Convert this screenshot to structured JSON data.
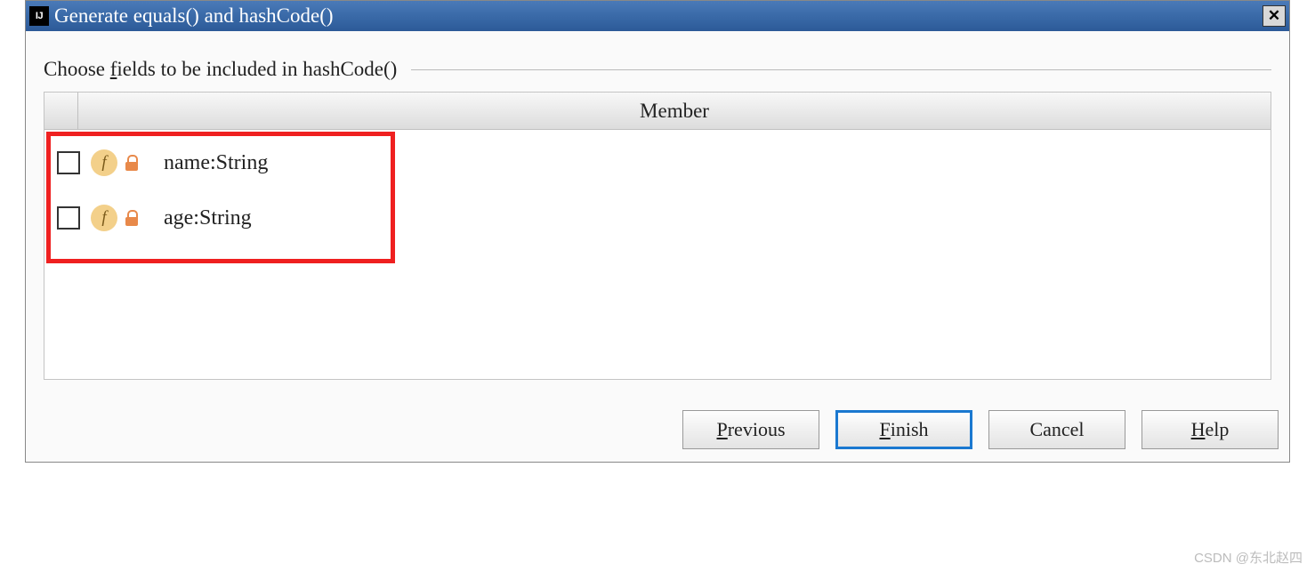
{
  "dialog": {
    "title": "Generate equals() and hashCode()",
    "icon_label": "IJ",
    "section_label_prefix": "Choose ",
    "section_label_mnemonic": "f",
    "section_label_rest": "ields to be included in hashCode()",
    "member_header": "Member",
    "fields": [
      {
        "label": "name:String",
        "icon_letter": "f"
      },
      {
        "label": "age:String",
        "icon_letter": "f"
      }
    ],
    "buttons": {
      "previous_p": "P",
      "previous_rest": "revious",
      "finish_f": "F",
      "finish_rest": "inish",
      "cancel": "Cancel",
      "help_h": "H",
      "help_rest": "elp"
    }
  },
  "watermark": "CSDN @东北赵四"
}
